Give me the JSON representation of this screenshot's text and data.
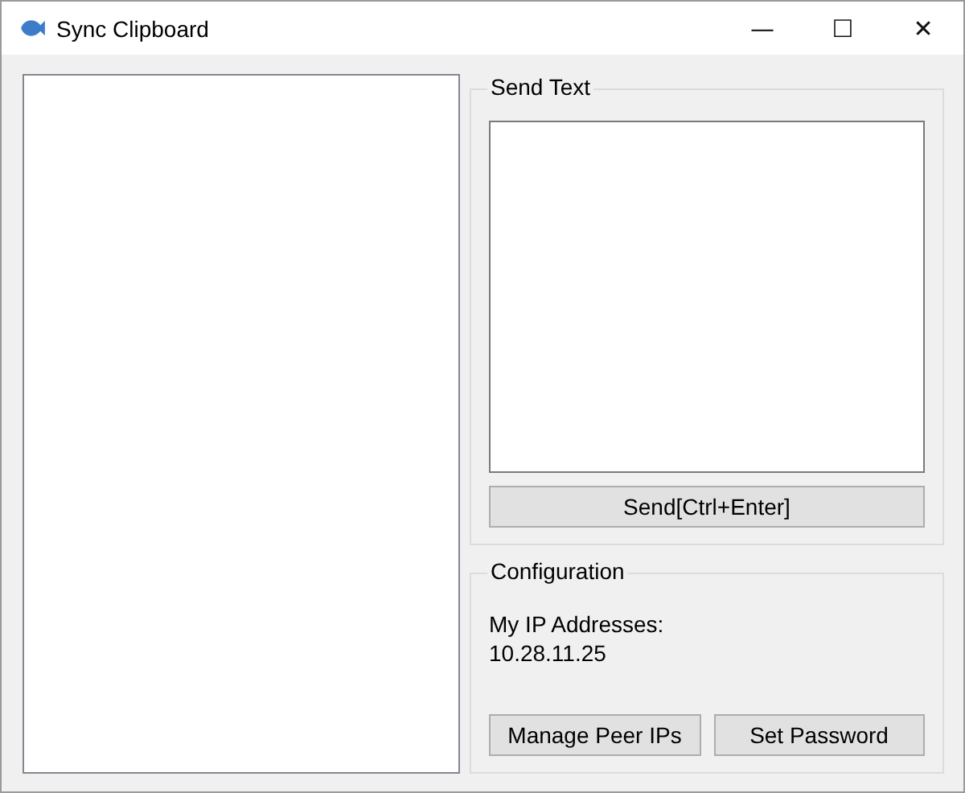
{
  "window": {
    "title": "Sync Clipboard",
    "controls": [
      "—",
      "☐",
      "✕"
    ]
  },
  "send_text": {
    "title": "Send Text",
    "button": "Send[Ctrl+Enter]"
  },
  "configuration": {
    "title": "Configuration",
    "label": "My IP Addresses:",
    "ip": "10.28.11.25",
    "buttons": [
      "Manage Peer IPs",
      "Set Password"
    ]
  }
}
